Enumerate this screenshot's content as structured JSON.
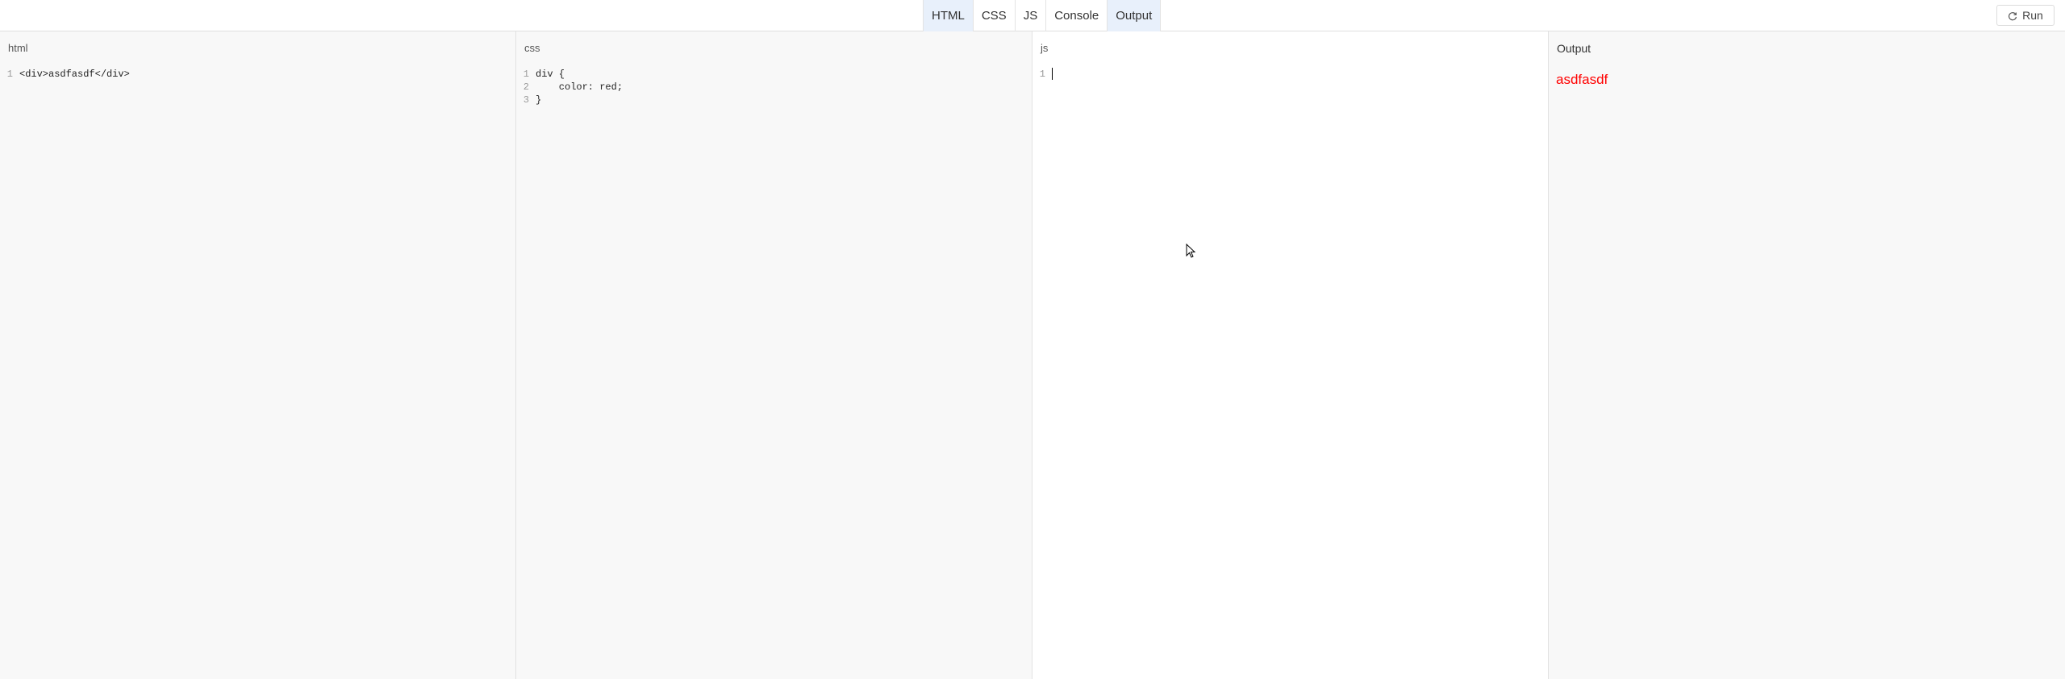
{
  "toolbar": {
    "tabs": [
      {
        "label": "HTML",
        "active": true
      },
      {
        "label": "CSS",
        "active": false
      },
      {
        "label": "JS",
        "active": false
      },
      {
        "label": "Console",
        "active": false
      },
      {
        "label": "Output",
        "active": true
      }
    ],
    "run_label": "Run",
    "run_icon": "refresh-icon"
  },
  "panes": {
    "html": {
      "title": "html",
      "lines": [
        {
          "num": "1",
          "text": "<div>asdfasdf</div>"
        }
      ]
    },
    "css": {
      "title": "css",
      "lines": [
        {
          "num": "1",
          "text": "div {"
        },
        {
          "num": "2",
          "text": "    color: red;"
        },
        {
          "num": "3",
          "text": "}"
        }
      ]
    },
    "js": {
      "title": "js",
      "lines": [
        {
          "num": "1",
          "text": ""
        }
      ]
    },
    "output": {
      "title": "Output",
      "text": "asdfasdf",
      "text_color": "#ff0000"
    }
  },
  "colors": {
    "active_tab": "#e8f0fb",
    "pane_bg": "#f8f8f8",
    "js_pane_bg": "#ffffff"
  }
}
